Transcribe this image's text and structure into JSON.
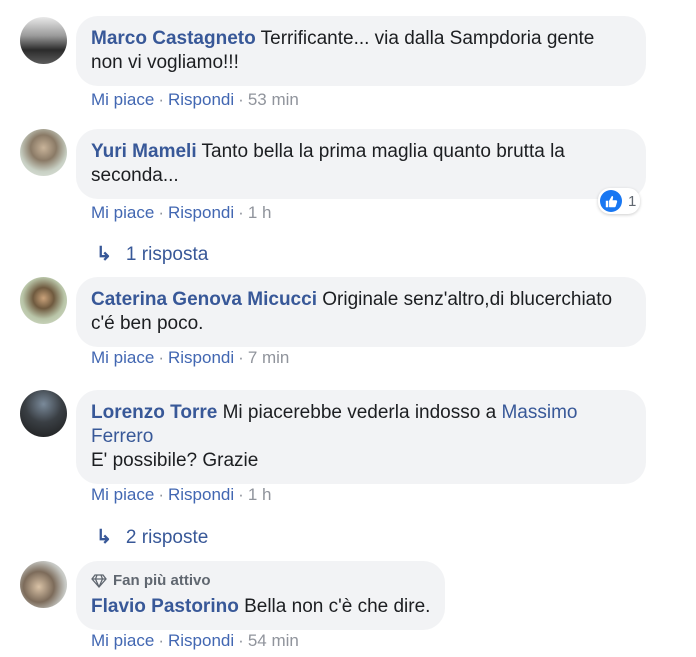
{
  "comments": [
    {
      "author": "Marco Castagneto",
      "text": "Terrificante... via dalla Sampdoria gente non vi vogliamo!!!",
      "like": "Mi piace",
      "reply": "Rispondi",
      "time": "53 min"
    },
    {
      "author": "Yuri Mameli",
      "text": "Tanto bella la prima maglia quanto brutta la seconda...",
      "like": "Mi piace",
      "reply": "Rispondi",
      "time": "1 h",
      "reaction_count": "1",
      "replies_label": "1 risposta"
    },
    {
      "author": "Caterina Genova Micucci",
      "text": "Originale senz'altro,di blucerchiato c'é ben poco.",
      "like": "Mi piace",
      "reply": "Rispondi",
      "time": "7 min"
    },
    {
      "author": "Lorenzo Torre",
      "text_before": "Mi piacerebbe vederla indosso a",
      "mention": "Massimo Ferrero",
      "text_after": "E' possibile? Grazie",
      "like": "Mi piace",
      "reply": "Rispondi",
      "time": "1 h",
      "replies_label": "2 risposte"
    },
    {
      "badge": "Fan più attivo",
      "author": "Flavio Pastorino",
      "text": "Bella non c'è che dire.",
      "like": "Mi piace",
      "reply": "Rispondi",
      "time": "54 min"
    }
  ],
  "colors": {
    "link": "#385898",
    "action_link": "#4267b2",
    "bubble_bg": "#f2f3f5",
    "meta_gray": "#90949c",
    "like_blue": "#1877f2"
  }
}
